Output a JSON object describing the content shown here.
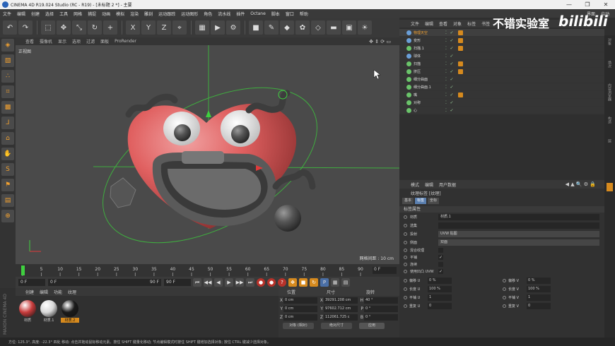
{
  "window": {
    "title": "CINEMA 4D R19.024 Studio (RC - R19) - [未标题 2 *] - 主要",
    "controls": [
      "—",
      "❐",
      "✕"
    ]
  },
  "menubar": {
    "items": [
      "文件",
      "编辑",
      "创建",
      "选择",
      "工具",
      "网格",
      "捕捉",
      "动画",
      "模拟",
      "渲染",
      "雕刻",
      "运动跟踪",
      "运动图形",
      "角色",
      "流水线",
      "插件",
      "Octane",
      "脚本",
      "窗口",
      "帮助"
    ],
    "right": [
      "界面",
      "启动"
    ]
  },
  "toolbar": {
    "icons": [
      "undo-icon",
      "redo-icon",
      "select-icon",
      "move-icon",
      "scale-icon",
      "rotate-icon",
      "add-icon",
      "x-axis-icon",
      "y-axis-icon",
      "z-axis-icon",
      "coord-icon",
      "render-view-icon",
      "render-icon",
      "render-settings-icon",
      "cube-icon",
      "pen-icon",
      "subdiv-icon",
      "deformer-icon",
      "scene-icon",
      "floor-icon",
      "camera-icon",
      "light-icon"
    ],
    "glyphs": [
      "↶",
      "↷",
      "⬚",
      "✥",
      "⤡",
      "↻",
      "+",
      "X",
      "Y",
      "Z",
      "⌖",
      "▦",
      "▶",
      "⚙",
      "■",
      "✎",
      "◆",
      "✿",
      "◇",
      "▬",
      "▣",
      "☀"
    ]
  },
  "leftbar": {
    "icons": [
      "model-icon",
      "texture-icon",
      "points-icon",
      "edges-icon",
      "polygons-icon",
      "axis-icon",
      "uv-icon",
      "paint-icon",
      "snap-icon",
      "solo-icon",
      "workplane-icon",
      "lock-icon"
    ],
    "glyphs": [
      "◈",
      "▧",
      "∴",
      "⌗",
      "▩",
      "⅃",
      "⌂",
      "✋",
      "S",
      "⚑",
      "▤",
      "⊕"
    ]
  },
  "viewport": {
    "menu": [
      "查看",
      "摄像机",
      "显示",
      "选项",
      "过滤",
      "面板",
      "ProRender"
    ],
    "nav": "✥ ⇕ ⟳ ▭",
    "label": "正视图",
    "grid_distance": "网格间距 : 10 cm"
  },
  "timeline": {
    "ticks": [
      "0",
      "5",
      "10",
      "15",
      "20",
      "25",
      "30",
      "35",
      "40",
      "45",
      "50",
      "55",
      "60",
      "65",
      "70",
      "75",
      "80",
      "85",
      "90"
    ],
    "current_frame": "0 F"
  },
  "transport": {
    "start": "0 F",
    "slider_start": "0 F",
    "slider_end": "90 F",
    "end": "90 F",
    "buttons": [
      "⏮",
      "◀◀",
      "◀",
      "▶",
      "▶▶",
      "⏭"
    ],
    "record_buttons": [
      "●",
      "●",
      "?",
      "✥",
      "■",
      "↻",
      "P",
      "▦",
      "▤"
    ]
  },
  "material_panel": {
    "menu": [
      "创建",
      "编辑",
      "功能",
      "纹理"
    ],
    "materials": [
      {
        "label": "材质",
        "color": "#c83c3c"
      },
      {
        "label": "材质.1",
        "color": "#d8d8d8"
      },
      {
        "label": "材质.2",
        "color": "#1a1a1a"
      }
    ],
    "brand": "MAXON CINEMA 4D"
  },
  "coordinates": {
    "headers": [
      "位置",
      "尺寸",
      "旋转"
    ],
    "rows": [
      {
        "p_label": "X",
        "p": "0 cm",
        "s_label": "X",
        "s": "39291.208 cm",
        "r_label": "H",
        "r": "40 °"
      },
      {
        "p_label": "Y",
        "p": "0 cm",
        "s_label": "Y",
        "s": "97602.712 cm",
        "r_label": "P",
        "r": "0 °"
      },
      {
        "p_label": "Z",
        "p": "0 cm",
        "s_label": "Z",
        "s": "112061.725 c",
        "r_label": "B",
        "r": "0 °"
      }
    ],
    "mode": "对象 (相对)",
    "size_mode": "绝对尺寸",
    "apply": "应用"
  },
  "statusbar": {
    "text": "方位: 125.3°, 高度: -22.3° 四处     移动: 点击并拖动鼠标移动元素。按住 SHIFT 键量化移动; 节点编辑模式时按住 SHIFT 键增加选择对象; 按住 CTRL 键减少选择对象。"
  },
  "object_manager": {
    "menu": [
      "文件",
      "编辑",
      "查看",
      "对象",
      "标签",
      "书签"
    ],
    "objects": [
      {
        "name": "物理天空",
        "color": "#6a9fd8",
        "tag": true
      },
      {
        "name": "变形",
        "color": "#6a9fd8",
        "tag": true
      },
      {
        "name": "扫描.1",
        "color": "#6ac46a",
        "tag": true
      },
      {
        "name": "球体",
        "color": "#6a9fd8",
        "tag": false
      },
      {
        "name": "扫描",
        "color": "#6ac46a",
        "tag": true
      },
      {
        "name": "挤压",
        "color": "#6ac46a",
        "tag": true
      },
      {
        "name": "细分曲面",
        "color": "#6ac46a",
        "tag": false
      },
      {
        "name": "细分曲面.1",
        "color": "#6ac46a",
        "tag": false
      },
      {
        "name": "嘴",
        "color": "#6ac46a",
        "tag": true
      },
      {
        "name": "对称",
        "color": "#6ac46a",
        "tag": false
      },
      {
        "name": "心",
        "color": "#6ac46a",
        "tag": false
      }
    ],
    "selected_index": 0
  },
  "watermark": {
    "text": "不错实验室",
    "logo": "bilibili"
  },
  "right_tabs": [
    "对象",
    "场次",
    "内容浏览器",
    "构造",
    "层"
  ],
  "attributes": {
    "menu": [
      "模式",
      "编辑",
      "用户数据"
    ],
    "nav": "◀ ▲ 🔍 ⚙ 🔒",
    "title": "纹理标签 [纹理]",
    "tabs": [
      "基本",
      "标签",
      "坐标"
    ],
    "active_tab": 1,
    "section": "标签属性",
    "fields": [
      {
        "label": "材质",
        "value": "材质.1"
      },
      {
        "label": "选集",
        "value": ""
      }
    ],
    "dropdowns": [
      {
        "label": "投射",
        "value": "UVW 贴图"
      },
      {
        "label": "侧面",
        "value": "双面"
      }
    ],
    "checks": [
      {
        "label": "混合纹理",
        "value": ""
      },
      {
        "label": "平铺",
        "value": "✓"
      },
      {
        "label": "连续",
        "value": ""
      },
      {
        "label": "使用凹凸 UVW",
        "value": "✓"
      }
    ],
    "grid": [
      {
        "label": "偏移 U",
        "value": "0 %"
      },
      {
        "label": "偏移 V",
        "value": "0 %"
      },
      {
        "label": "长度 U",
        "value": "100 %"
      },
      {
        "label": "长度 V",
        "value": "100 %"
      },
      {
        "label": "平铺 U",
        "value": "1"
      },
      {
        "label": "平铺 V",
        "value": "1"
      },
      {
        "label": "重复 U",
        "value": "0"
      },
      {
        "label": "重复 V",
        "value": "0"
      }
    ]
  }
}
